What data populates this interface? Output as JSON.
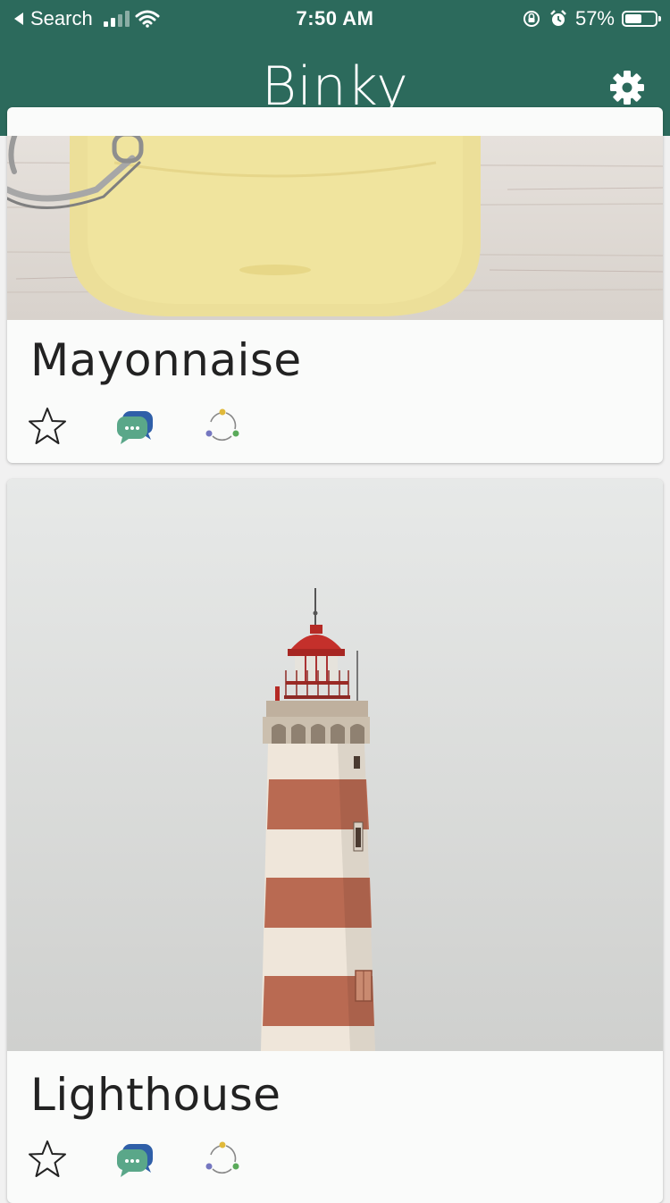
{
  "status_bar": {
    "back_label": "Search",
    "time": "7:50 AM",
    "battery_percent": "57%",
    "battery_level": 0.57
  },
  "app": {
    "title": "Binky",
    "settings_icon": "gear-icon"
  },
  "cards": [
    {
      "title": "Mayonnaise",
      "photo": "mayonnaise-jar-photo",
      "actions": [
        "star-icon",
        "chat-icon",
        "share-icon"
      ]
    },
    {
      "title": "Lighthouse",
      "photo": "lighthouse-photo",
      "actions": [
        "star-icon",
        "chat-icon",
        "share-icon"
      ]
    }
  ],
  "colors": {
    "brand": "#2c6a5c",
    "card_bg": "#fafbfa",
    "chat_green": "#5aa789",
    "chat_blue": "#2f5fa8"
  }
}
